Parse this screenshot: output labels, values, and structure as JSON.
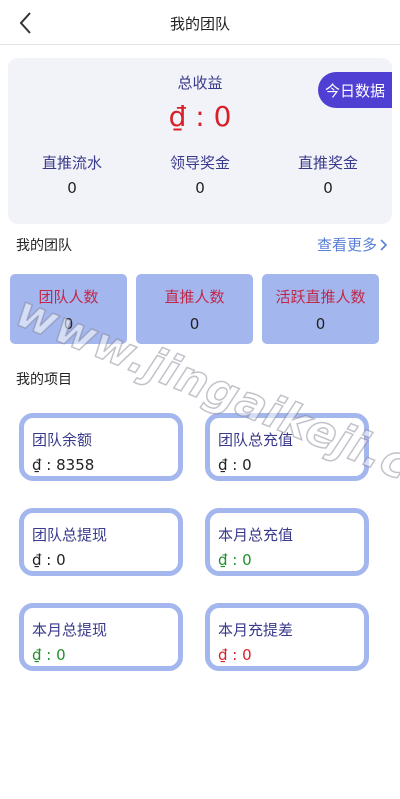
{
  "header": {
    "title": "我的团队",
    "back_icon": "chevron-left-icon"
  },
  "summary": {
    "total_label": "总收益",
    "total_value": "₫ : 0",
    "today_button": "今日数据",
    "stats": [
      {
        "label": "直推流水",
        "value": "0"
      },
      {
        "label": "领导奖金",
        "value": "0"
      },
      {
        "label": "直推奖金",
        "value": "0"
      }
    ]
  },
  "team_section": {
    "title": "我的团队",
    "more_link": "查看更多"
  },
  "team_cards": [
    {
      "label": "团队人数",
      "value": "0"
    },
    {
      "label": "直推人数",
      "value": "0"
    },
    {
      "label": "活跃直推人数",
      "value": "0"
    }
  ],
  "project_section": {
    "title": "我的项目"
  },
  "project_cards": [
    {
      "label": "团队余额",
      "value": "₫ : 8358",
      "color": "#222222"
    },
    {
      "label": "团队总充值",
      "value": "₫ : 0",
      "color": "#222222"
    },
    {
      "label": "团队总提现",
      "value": "₫ : 0",
      "color": "#222222"
    },
    {
      "label": "本月总充值",
      "value": "₫ : 0",
      "color": "#1f8f2a"
    },
    {
      "label": "本月总提现",
      "value": "₫ : 0",
      "color": "#1f8f2a"
    },
    {
      "label": "本月充提差",
      "value": "₫ : 0",
      "color": "#d8202a"
    }
  ],
  "watermark": "www.jingaikeji.com",
  "colors": {
    "accent": "#4f3fd3",
    "card_fill": "#a3b6ee",
    "negative": "#d8202a",
    "positive": "#1f8f2a"
  }
}
